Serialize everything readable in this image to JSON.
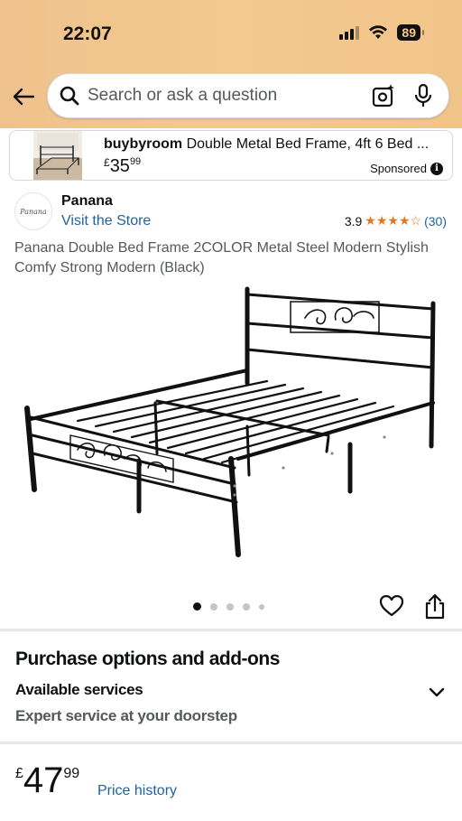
{
  "status_bar": {
    "time": "22:07",
    "battery": "89"
  },
  "search": {
    "placeholder": "Search or ask a question"
  },
  "sponsored_ad": {
    "seller": "buybyroom",
    "title": "Double Metal Bed Frame, 4ft 6 Bed ...",
    "price_currency": "£",
    "price_whole": "35",
    "price_fraction": "99",
    "label": "Sponsored"
  },
  "store": {
    "logo_text": "Panana",
    "brand": "Panana",
    "visit_link": "Visit the Store",
    "rating_value": "3.9",
    "rating_stars": 3.9,
    "rating_count": "(30)"
  },
  "product": {
    "title": "Panana Double Bed Frame 2COLOR Metal Steel Modern Stylish Comfy Strong Modern (Black)",
    "image_count": 5,
    "active_image": 1
  },
  "purchase_options": {
    "heading": "Purchase options and add-ons",
    "services_label": "Available services",
    "services_sub": "Expert service at your doorstep"
  },
  "price": {
    "currency": "£",
    "whole": "47",
    "fraction": "99",
    "history_link": "Price history"
  },
  "colors": {
    "header": "#f3c98f",
    "link": "#2162a1",
    "star": "#de7921"
  },
  "icons": [
    "back-arrow-icon",
    "search-icon",
    "camera-icon",
    "microphone-icon",
    "info-icon",
    "star-icon",
    "heart-icon",
    "share-icon",
    "chevron-down-icon",
    "wifi-icon",
    "signal-icon",
    "battery-icon"
  ]
}
